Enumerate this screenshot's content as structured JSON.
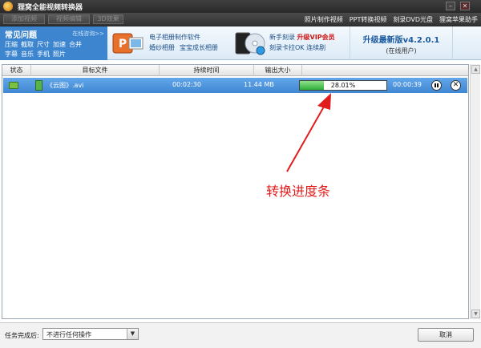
{
  "window": {
    "title": "狸窝全能视频转换器",
    "minimize_glyph": "–",
    "close_glyph": "✕"
  },
  "toolbar": {
    "buttons": [
      "添加视频",
      "视频编辑",
      "3D效果"
    ],
    "links": [
      "照片制作视频",
      "PPT转换视频",
      "刻录DVD光盘",
      "狸窝苹果助手"
    ]
  },
  "faq": {
    "title": "常见问题",
    "consult": "在线咨询>>",
    "row1": [
      "压缩",
      "截取",
      "尺寸",
      "加速",
      "合并"
    ],
    "row2": [
      "字幕",
      "音乐",
      "手机",
      "照片"
    ]
  },
  "promo1": {
    "line1": "电子相册制作软件",
    "line2a": "婚纱相册",
    "line2b": "宝宝成长相册"
  },
  "promo2": {
    "line1a": "新手刻录",
    "vip": "升级VIP会员",
    "line2": "刻录卡拉OK 连续剧"
  },
  "upgrade": {
    "title": "升级最新版v4.2.0.1",
    "subtitle": "(在线用户)"
  },
  "table": {
    "headers": [
      "状态",
      "目标文件",
      "持续时间",
      "输出大小",
      ""
    ],
    "rows": [
      {
        "file": "《云图》.avi",
        "duration": "00:02:30",
        "size": "11.44 MB",
        "progress_text": "28.01%",
        "progress": 0.2801,
        "remaining": "00:00:39"
      }
    ]
  },
  "annotation": {
    "label": "转换进度条",
    "color": "#e21c1c"
  },
  "bottom": {
    "after_label": "任务完成后:",
    "after_value": "不进行任何操作",
    "cancel": "取消"
  },
  "colors": {
    "selected_row": "#4a8fd8",
    "progress_fill": "#3cb443",
    "faq_bg": "#3d86cf"
  }
}
